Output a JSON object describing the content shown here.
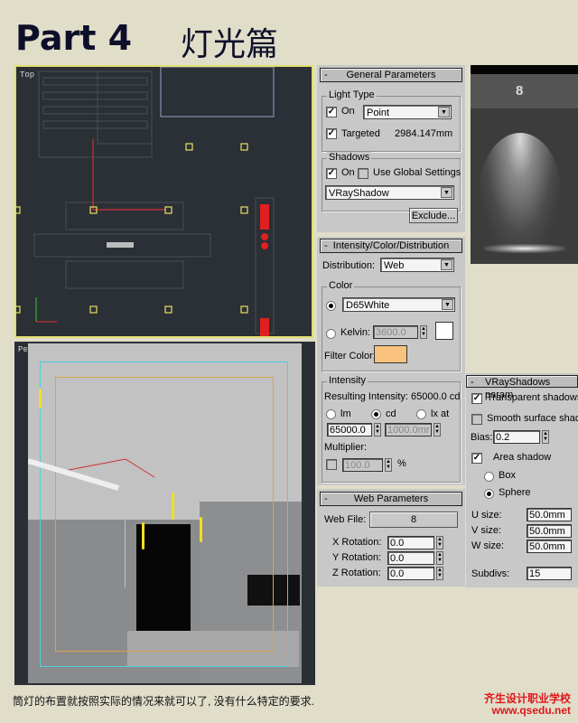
{
  "header": {
    "title": "Part 4",
    "subtitle": "灯光篇"
  },
  "viewports": {
    "top": {
      "label": "Top"
    },
    "perspective": {
      "label": "Pe"
    }
  },
  "general_parameters": {
    "title": "General Parameters",
    "collapse_symbol": "-",
    "light_type": {
      "group_label": "Light Type",
      "on_label": "On",
      "on_checked": true,
      "type_value": "Point",
      "targeted_label": "Targeted",
      "targeted_checked": true,
      "target_distance": "2984.147mm"
    },
    "shadows": {
      "group_label": "Shadows",
      "on_label": "On",
      "on_checked": true,
      "use_global_label": "Use Global Settings",
      "use_global_checked": false,
      "shadow_type": "VRayShadow",
      "exclude_button": "Exclude..."
    }
  },
  "intensity_color_distribution": {
    "title": "Intensity/Color/Distribution",
    "collapse_symbol": "-",
    "distribution_label": "Distribution:",
    "distribution_value": "Web",
    "color": {
      "group_label": "Color",
      "preset_value": "D65White",
      "preset_selected": true,
      "kelvin_label": "Kelvin:",
      "kelvin_value": "3600.0",
      "kelvin_swatch": "#ffffff",
      "filter_label": "Filter Color:",
      "filter_color": "#f9c27e"
    },
    "intensity": {
      "group_label": "Intensity",
      "resulting": "Resulting Intensity: 65000.0 cd",
      "unit_lm": "lm",
      "unit_cd": "cd",
      "unit_lx": "lx at",
      "selected_unit": "cd",
      "value": "65000.0",
      "lx_distance": "1000.0mr",
      "multiplier_label": "Multiplier:",
      "multiplier_checked": false,
      "multiplier_value": "100.0",
      "percent": "%"
    }
  },
  "web_parameters": {
    "title": "Web Parameters",
    "collapse_symbol": "-",
    "web_file_label": "Web File:",
    "web_file_value": "8",
    "x_rotation_label": "X Rotation:",
    "x_rotation": "0.0",
    "y_rotation_label": "Y Rotation:",
    "y_rotation": "0.0",
    "z_rotation_label": "Z Rotation:",
    "z_rotation": "0.0"
  },
  "preview": {
    "web_file_number": "8"
  },
  "vray_shadows": {
    "title": "VRayShadows param",
    "collapse_symbol": "-",
    "transparent_label": "Transparent shadows",
    "transparent_checked": true,
    "smooth_label": "Smooth surface shad",
    "smooth_checked": false,
    "bias_label": "Bias:",
    "bias_value": "0.2",
    "area_label": "Area shadow",
    "area_checked": true,
    "box_label": "Box",
    "sphere_label": "Sphere",
    "selected_shape": "Sphere",
    "u_label": "U size:",
    "u_value": "50.0mm",
    "v_label": "V size:",
    "v_value": "50.0mm",
    "w_label": "W size:",
    "w_value": "50.0mm",
    "subdivs_label": "Subdivs:",
    "subdivs_value": "15"
  },
  "footer": {
    "caption": "筒灯的布置就按照实际的情况来就可以了, 没有什么特定的要求.",
    "brand_name": "齐生设计职业学校",
    "brand_url": "www.qsedu.net"
  },
  "colors": {
    "viewport_active_border": "#e2df6e",
    "panel_bg": "#c8c8c8",
    "page_bg": "#e0ddc9",
    "brand_red": "#e0161b"
  }
}
